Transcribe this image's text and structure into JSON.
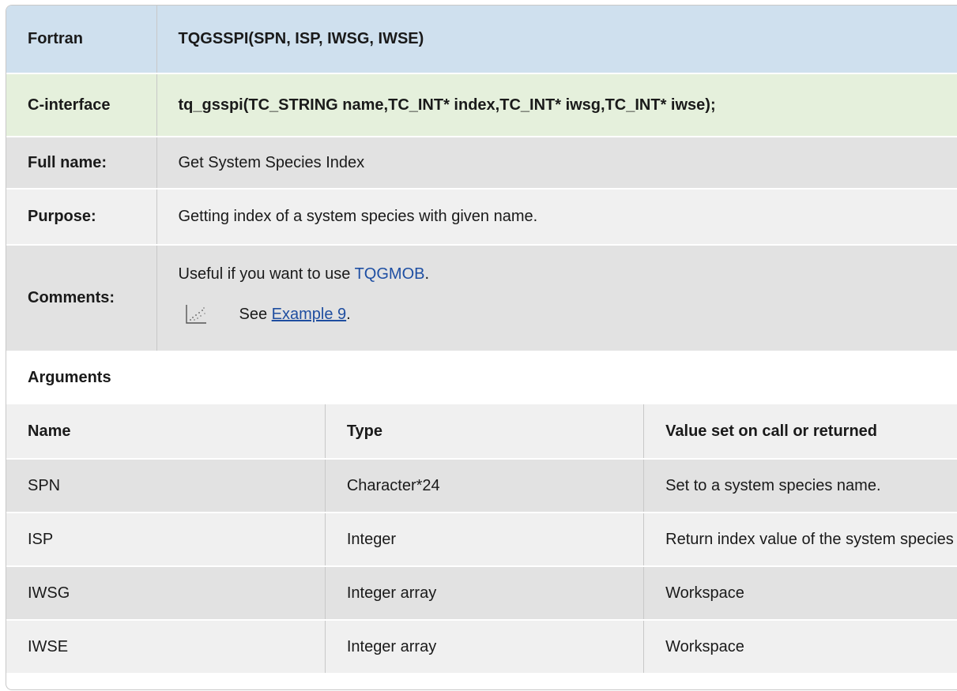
{
  "header": {
    "fortran_label": "Fortran",
    "fortran_value": "TQGSSPI(SPN, ISP, IWSG, IWSE)",
    "c_label": "C-interface",
    "c_value": "tq_gsspi(TC_STRING name,TC_INT* index,TC_INT* iwsg,TC_INT* iwse);"
  },
  "info": {
    "fullname_label": "Full name:",
    "fullname_value": "Get System Species Index",
    "purpose_label": "Purpose:",
    "purpose_value": "Getting index of a system species with given name.",
    "comments_label": "Comments:",
    "comments_text_before": "Useful if you want to use ",
    "comments_link": "TQGMOB",
    "comments_text_after": ".",
    "example_prefix": "See ",
    "example_link": "Example 9",
    "example_suffix": ".",
    "example_icon": "scatter-plot-icon"
  },
  "arguments": {
    "title": "Arguments",
    "headers": [
      "Name",
      "Type",
      "Value set on call or returned"
    ],
    "rows": [
      {
        "name": "SPN",
        "type": "Character*24",
        "value": "Set to a system species name."
      },
      {
        "name": "ISP",
        "type": "Integer",
        "value": "Return index value of the system species"
      },
      {
        "name": "IWSG",
        "type": "Integer array",
        "value": "Workspace"
      },
      {
        "name": "IWSE",
        "type": "Integer array",
        "value": "Workspace"
      }
    ]
  },
  "colors": {
    "fortran_bg": "#cfe0ee",
    "c_interface_bg": "#e5f0dc",
    "row_dark": "#e2e2e2",
    "row_light": "#f0f0f0",
    "link": "#1e4fa3"
  }
}
